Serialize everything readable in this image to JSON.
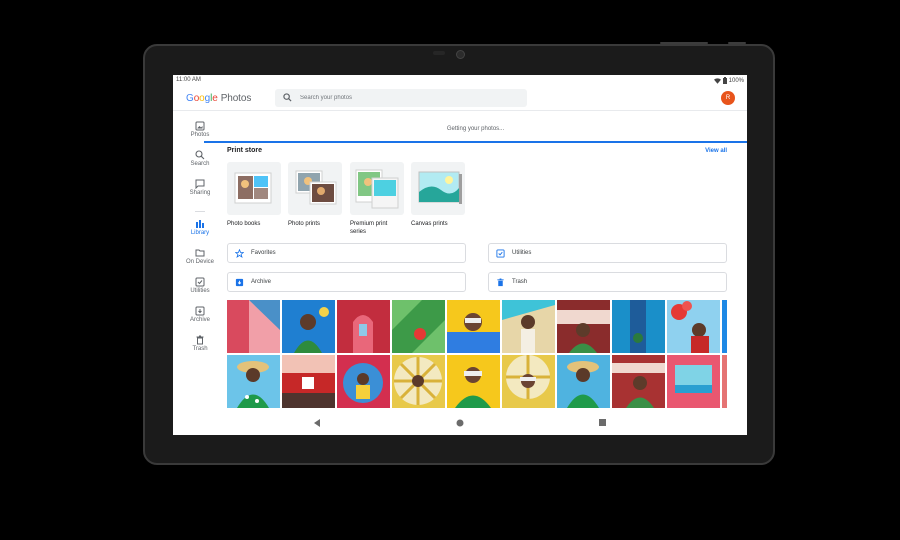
{
  "status": {
    "time": "11:00 AM",
    "battery": "100%"
  },
  "app": {
    "brand_letters": [
      "G",
      "o",
      "o",
      "g",
      "l",
      "e"
    ],
    "product": "Photos"
  },
  "search": {
    "placeholder": "Search your photos"
  },
  "account": {
    "initial": "R"
  },
  "nav": [
    {
      "label": "Photos",
      "icon": "photo-icon"
    },
    {
      "label": "Search",
      "icon": "search-icon"
    },
    {
      "label": "Sharing",
      "icon": "chat-icon"
    },
    {
      "label": "Library",
      "icon": "library-icon"
    },
    {
      "label": "On Device",
      "icon": "folder-icon"
    },
    {
      "label": "Utilities",
      "icon": "utilities-icon"
    },
    {
      "label": "Archive",
      "icon": "archive-icon"
    },
    {
      "label": "Trash",
      "icon": "trash-icon"
    }
  ],
  "main": {
    "loading_text": "Getting your photos...",
    "print_store": {
      "title": "Print store",
      "view_all": "View all",
      "items": [
        {
          "label": "Photo books"
        },
        {
          "label": "Photo prints"
        },
        {
          "label": "Premium print series"
        },
        {
          "label": "Canvas prints"
        }
      ]
    },
    "shortcuts": [
      {
        "label": "Favorites",
        "icon": "star-icon"
      },
      {
        "label": "Utilities",
        "icon": "utilities-icon"
      },
      {
        "label": "Archive",
        "icon": "archive-icon"
      },
      {
        "label": "Trash",
        "icon": "trash-icon"
      }
    ]
  },
  "colors": {
    "accent": "#1a73e8",
    "avatar": "#e8541b"
  }
}
